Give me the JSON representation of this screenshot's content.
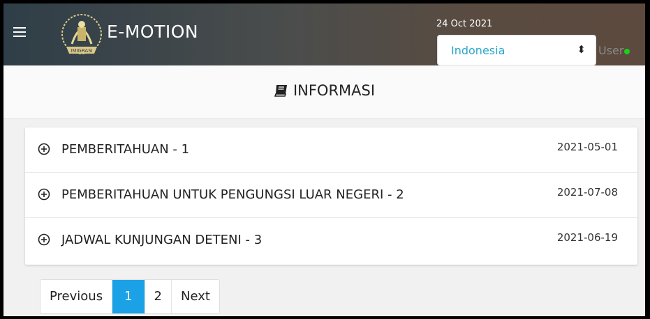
{
  "app": {
    "brand": "E-MOTION",
    "logo_text": "IMIGRASI"
  },
  "topbar": {
    "date": "24 Oct 2021",
    "country_selected": "Indonesia",
    "user_label": "User"
  },
  "header": {
    "title": "INFORMASI"
  },
  "items": [
    {
      "title": "PEMBERITAHUAN - 1",
      "date": "2021-05-01"
    },
    {
      "title": "PEMBERITAHUAN UNTUK PENGUNGSI LUAR NEGERI - 2",
      "date": "2021-07-08"
    },
    {
      "title": "JADWAL KUNJUNGAN DETENI - 3",
      "date": "2021-06-19"
    }
  ],
  "pagination": {
    "previous": "Previous",
    "pages": [
      "1",
      "2"
    ],
    "current": "1",
    "next": "Next"
  },
  "colors": {
    "accent": "#1aa1e6",
    "select_text": "#2aa6c9",
    "online": "#19d219"
  }
}
